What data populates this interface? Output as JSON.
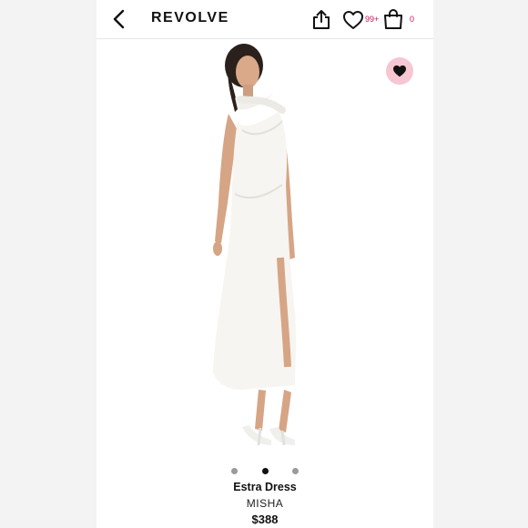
{
  "header": {
    "brand": "REVOLVE",
    "favorites_count": "99+",
    "bag_count": "0",
    "icons": {
      "back": "chevron-left-icon",
      "share": "share-icon",
      "favorites": "heart-outline-icon",
      "bag": "shopping-bag-icon"
    }
  },
  "gallery": {
    "image_count": 3,
    "active_index": 1,
    "wishlist_icon": "heart-filled-icon",
    "wishlist_color": "#f7c6d3"
  },
  "product": {
    "name": "Estra Dress",
    "brand": "MISHA",
    "price": "$388"
  },
  "colors": {
    "accent": "#c2185b",
    "text": "#111111"
  }
}
